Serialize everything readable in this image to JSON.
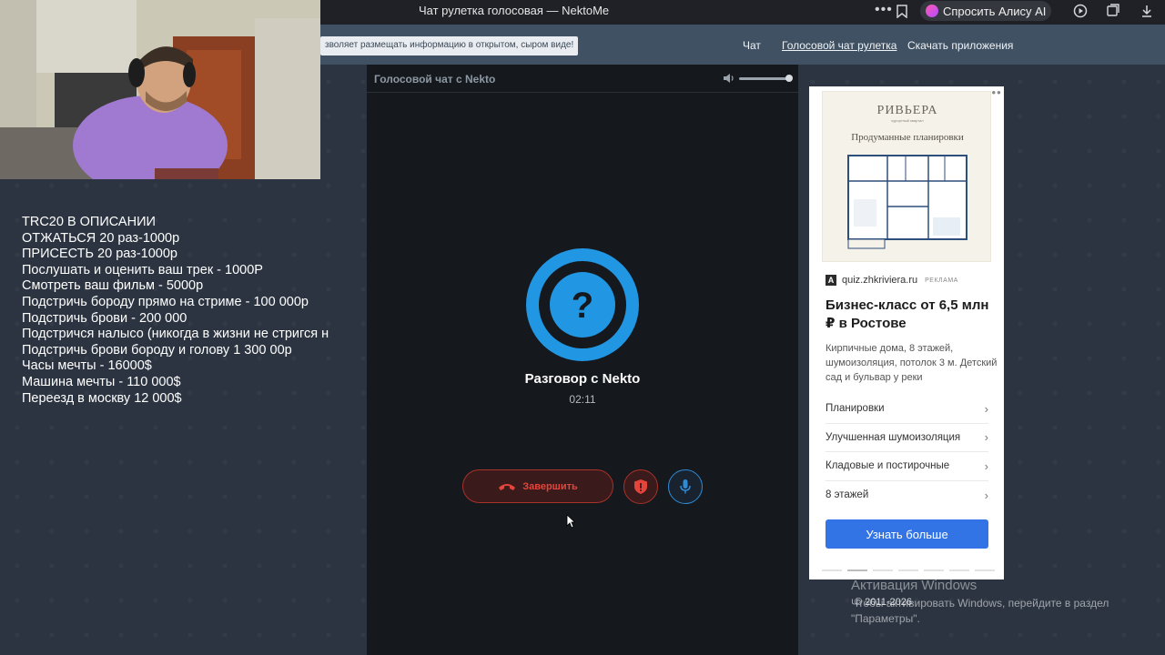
{
  "browser": {
    "tab_title": "Чат рулетка голосовая — NektoMe",
    "alice_button": "Спросить Алису AI"
  },
  "site": {
    "notice": "зволяет размещать информацию в открытом, сыром виде!",
    "nav": [
      "Чат",
      "Голосовой чат рулетка",
      "Скачать приложения"
    ],
    "nav_active_index": 1,
    "copyright": "© 2011-2026"
  },
  "stream_overlay": {
    "lines": [
      "TRC20 В ОПИСАНИИ",
      "ОТЖАТЬСЯ 20 раз-1000р",
      "ПРИСЕСТЬ 20 раз-1000р",
      "Послушать и оценить ваш трек - 1000Р",
      "Смотреть ваш фильм - 5000р",
      "Подстричь бороду прямо на стриме - 100 000р",
      "Подстричь брови - 200 000",
      "Подстричся налысо (никогда в жизни не стригся н",
      "Подстричь брови бороду и голову 1 300 00р",
      "Часы мечты - 16000$",
      "Машина мечты - 110 000$",
      "Переезд в москву 12 000$"
    ]
  },
  "chat": {
    "header_label": "Голосовой чат с Nekto",
    "volume_level": 0.95,
    "avatar_symbol": "?",
    "conversation_title": "Разговор с Nekto",
    "timer": "02:11",
    "end_button": "Завершить"
  },
  "ad": {
    "brand": "РИВЬЕРА",
    "brand_sub": "курортный квартал",
    "image_title": "Продуманные планировки",
    "logo_letter": "A",
    "domain": "quiz.zhkriviera.ru",
    "tag": "РЕКЛАМА",
    "headline": "Бизнес-класс от 6,5 млн ₽ в Ростове",
    "body": "Кирпичные дома, 8 этажей, шумоизоляция, потолок 3 м. Детский сад и бульвар у реки",
    "items": [
      "Планировки",
      "Улучшенная шумоизоляция",
      "Кладовые и постирочные",
      "8 этажей"
    ],
    "cta": "Узнать больше"
  },
  "windows_watermark": {
    "title": "Активация Windows",
    "text": "Чтобы активировать Windows, перейдите в раздел \"Параметры\"."
  },
  "colors": {
    "accent_blue": "#2196e3",
    "danger_red": "#e5443b",
    "panel_bg": "#15191d",
    "header_bg": "#3f5163",
    "cta_blue": "#3274e6"
  }
}
